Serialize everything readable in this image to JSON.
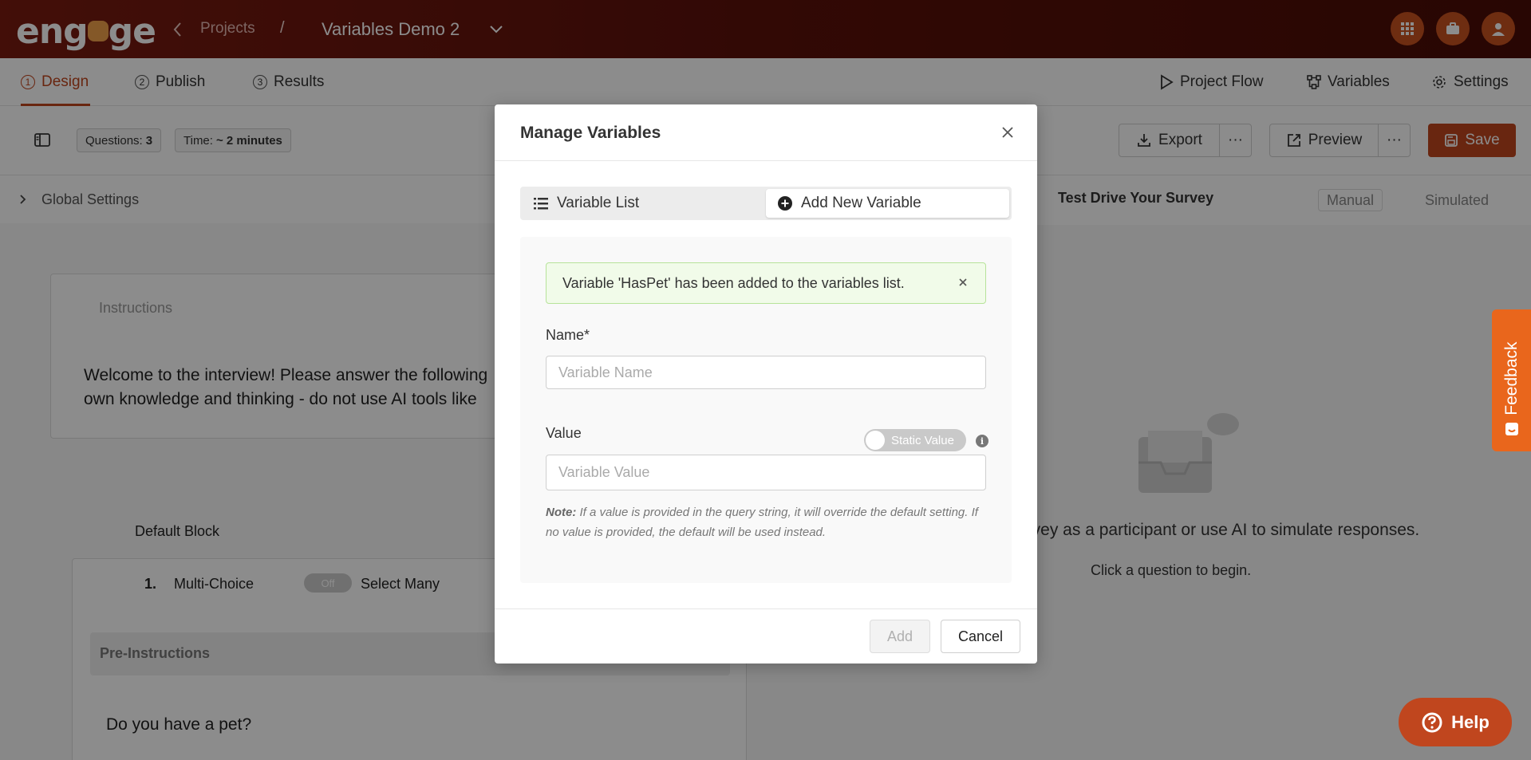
{
  "header": {
    "logo": "engage",
    "breadcrumb_projects": "Projects",
    "breadcrumb_separator": "/",
    "project_title": "Variables Demo 2"
  },
  "nav": {
    "tabs": [
      {
        "num": "1",
        "label": "Design"
      },
      {
        "num": "2",
        "label": "Publish"
      },
      {
        "num": "3",
        "label": "Results"
      }
    ],
    "right": {
      "project_flow": "Project Flow",
      "variables": "Variables",
      "settings": "Settings"
    }
  },
  "toolbar": {
    "questions_label": "Questions:",
    "questions_value": "3",
    "time_label": "Time:",
    "time_value": "~ 2 minutes",
    "export": "Export",
    "preview": "Preview",
    "save": "Save",
    "more": "···"
  },
  "background": {
    "global_settings": "Global Settings",
    "instructions": "Instructions",
    "welcome_line1": "Welcome to the interview! Please answer the following",
    "welcome_line2": "own knowledge and thinking - do not use AI tools like",
    "default_block": "Default Block",
    "q_num": "1.",
    "q_type": "Multi-Choice",
    "toggle_off": "Off",
    "select_many": "Select Many",
    "pre_instructions": "Pre-Instructions",
    "question_text": "Do you have a pet?",
    "test_drive_title": "Test Drive Your Survey",
    "manual": "Manual",
    "simulated": "Simulated",
    "test_drive_text": "urvey as a participant or use AI to simulate responses.",
    "click_to_begin": "Click a question to begin."
  },
  "modal": {
    "title": "Manage Variables",
    "tab_list": "Variable List",
    "tab_add": "Add New Variable",
    "alert": "Variable 'HasPet' has been added to the variables list.",
    "name_label": "Name*",
    "name_placeholder": "Variable Name",
    "name_value": "",
    "value_label": "Value",
    "static_toggle": "Static Value",
    "value_placeholder": "Variable Value",
    "value_value": "",
    "note_bold": "Note:",
    "note_text": "If a value is provided in the query string, it will override the default setting. If no value is provided, the default will be used instead.",
    "add_button": "Add",
    "cancel_button": "Cancel"
  },
  "feedback": "Feedback",
  "help": "Help",
  "colors": {
    "brand": "#c0461e",
    "header_bg": "#5b110a",
    "feedback_bg": "#e9661c",
    "alert_bg": "#f1fbe9"
  },
  "icons": [
    "chevron-left-icon",
    "chevron-down-icon",
    "apps-grid-icon",
    "toolbox-icon",
    "user-icon",
    "play-icon",
    "flow-icon",
    "gear-icon",
    "sidebar-toggle-icon",
    "download-icon",
    "external-link-icon",
    "save-icon",
    "close-icon",
    "list-icon",
    "plus-circle-icon",
    "info-icon",
    "help-circle-icon"
  ]
}
